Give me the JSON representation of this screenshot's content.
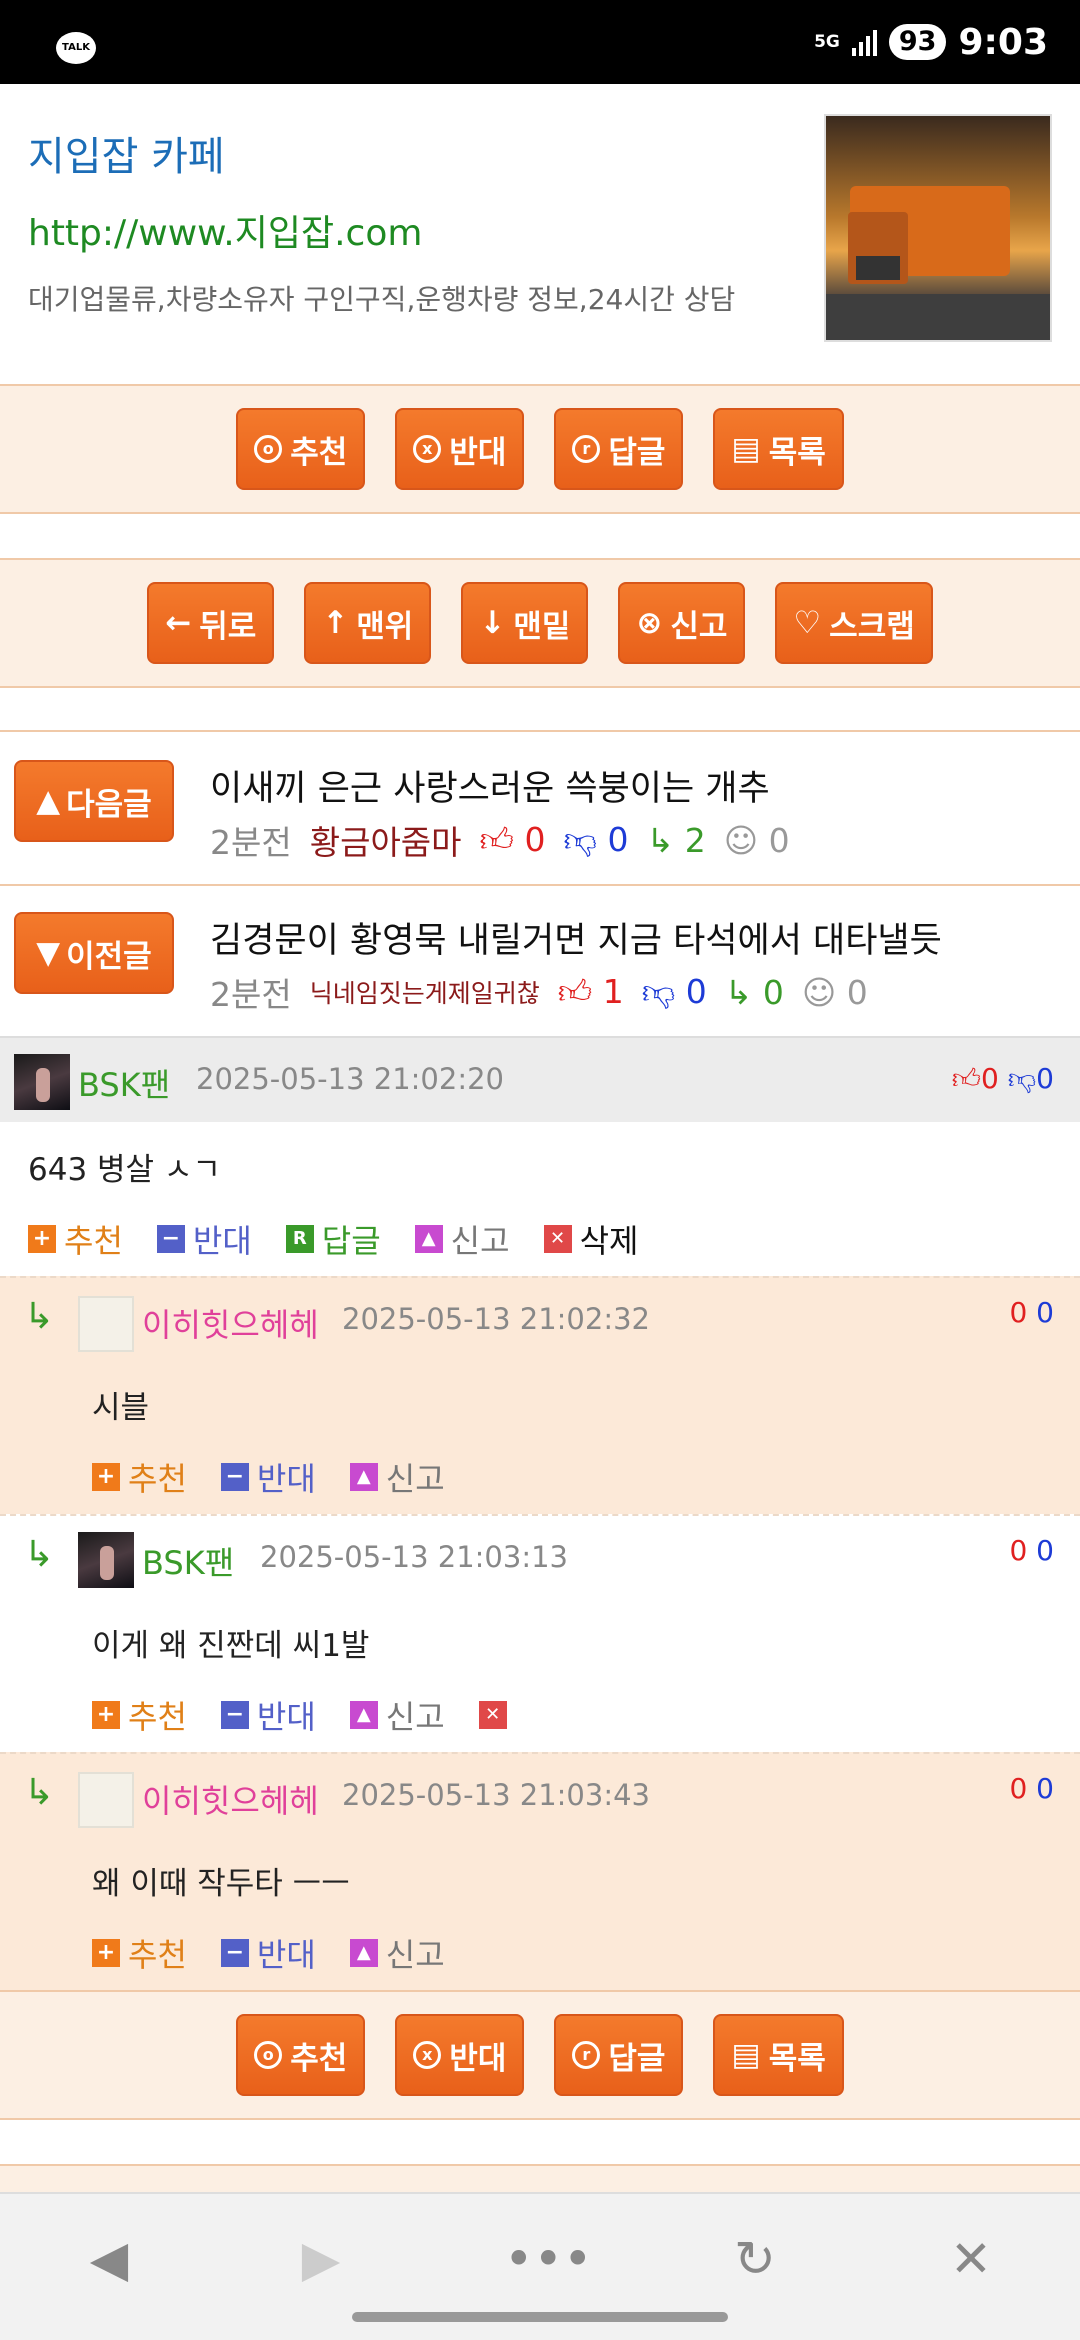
{
  "status": {
    "app": "TALK",
    "net": "5G",
    "battery": "93",
    "time": "9:03"
  },
  "ad": {
    "title": "지입잡 카페",
    "url": "http://www.지입잡.com",
    "desc": "대기업물류,차량소유자 구인구직,운행차량 정보,24시간 상담"
  },
  "bar1": [
    {
      "icon": "o",
      "label": "추천"
    },
    {
      "icon": "x",
      "label": "반대"
    },
    {
      "icon": "r",
      "label": "답글"
    },
    {
      "icon": "▤",
      "label": "목록"
    }
  ],
  "bar2": [
    {
      "icon": "←",
      "label": "뒤로"
    },
    {
      "icon": "↑",
      "label": "맨위"
    },
    {
      "icon": "↓",
      "label": "맨밑"
    },
    {
      "icon": "⊗",
      "label": "신고"
    },
    {
      "icon": "♡",
      "label": "스크랩"
    }
  ],
  "next": {
    "btn": "다음글",
    "title": "이새끼 은근 사랑스러운 쓱붕이는 개추",
    "time": "2분전",
    "author": "황금아줌마",
    "likes": "0",
    "dislikes": "0",
    "replies": "2",
    "views": "0"
  },
  "prev": {
    "btn": "이전글",
    "title": "김경문이 황영묵 내릴거면 지금 타석에서 대타낼듯",
    "time": "2분전",
    "author": "닉네임짓는게제일귀찮",
    "likes": "1",
    "dislikes": "0",
    "replies": "0",
    "views": "0"
  },
  "comment": {
    "name": "BSK팬",
    "date": "2025-05-13 21:02:20",
    "up": "0",
    "down": "0",
    "text": "643 병살 ㅅㄱ"
  },
  "actions": {
    "up": "추천",
    "down": "반대",
    "reply": "답글",
    "report": "신고",
    "delete": "삭제"
  },
  "replies": [
    {
      "name": "이히힛으헤헤",
      "date": "2025-05-13 21:02:32",
      "up": "0",
      "down": "0",
      "text": "시블"
    },
    {
      "name": "BSK팬",
      "date": "2025-05-13 21:03:13",
      "up": "0",
      "down": "0",
      "text": "이게 왜 진짠데 씨1발"
    },
    {
      "name": "이히힛으헤헤",
      "date": "2025-05-13 21:03:43",
      "up": "0",
      "down": "0",
      "text": "왜 이때 작두타 ㅡㅡ"
    }
  ],
  "colors": {
    "accent": "#ec6a20",
    "reply_bg": "#fce9d8"
  }
}
